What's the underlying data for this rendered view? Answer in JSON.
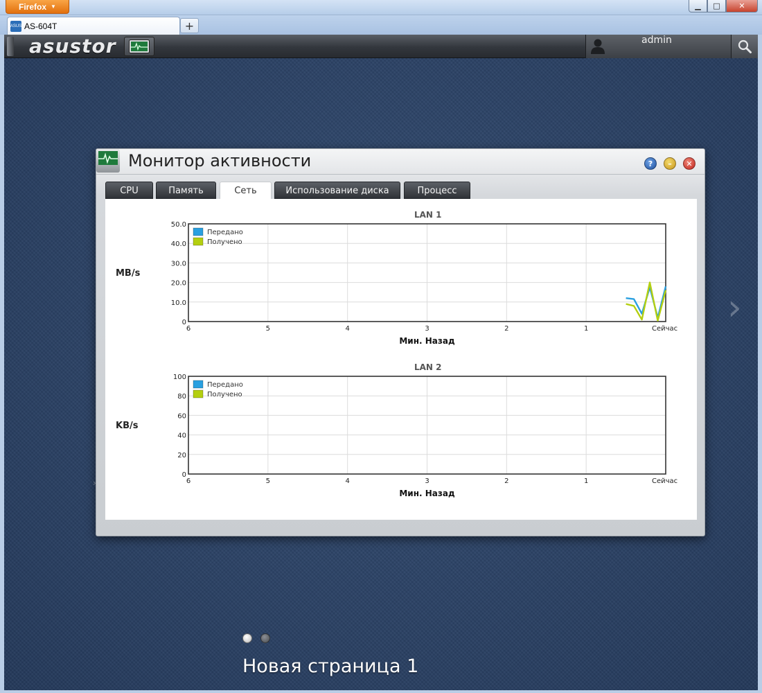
{
  "browser": {
    "menu_label": "Firefox",
    "tab_title": "AS-604T",
    "favicon_text": "ASUS",
    "new_tab_label": "+",
    "minimize": "▁",
    "maximize": "□",
    "close": "✕"
  },
  "topbar": {
    "brand": "asustor",
    "user": "admin"
  },
  "window": {
    "title": "Монитор активности",
    "help": "?",
    "minimize": "–",
    "close": "✕",
    "tabs": [
      {
        "label": "CPU",
        "active": false
      },
      {
        "label": "Память",
        "active": false
      },
      {
        "label": "Сеть",
        "active": true
      },
      {
        "label": "Использование диска",
        "active": false
      },
      {
        "label": "Процесс",
        "active": false
      }
    ]
  },
  "colors": {
    "sent": "#2aa0e0",
    "received": "#b4cf10"
  },
  "desktop": {
    "page_name": "Новая страница 1",
    "next_arrow": "›",
    "left_marker": "›"
  },
  "chart_data": [
    {
      "type": "line",
      "title": "LAN 1",
      "ylabel": "MB/s",
      "xlabel": "Мин. Назад",
      "x_ticks": [
        "6",
        "5",
        "4",
        "3",
        "2",
        "1",
        "Сейчас"
      ],
      "y_ticks": [
        "50.0",
        "40.0",
        "30.0",
        "20.0",
        "10.0",
        "0"
      ],
      "ylim": [
        0,
        50
      ],
      "xlim": [
        6,
        0
      ],
      "grid": true,
      "legend_position": "top-left",
      "series": [
        {
          "name": "Передано",
          "color_key": "sent",
          "x": [
            0.5,
            0.4,
            0.3,
            0.2,
            0.1,
            0.0
          ],
          "y": [
            12,
            11.5,
            4,
            17.5,
            2,
            18
          ]
        },
        {
          "name": "Получено",
          "color_key": "received",
          "x": [
            0.5,
            0.4,
            0.3,
            0.2,
            0.1,
            0.0
          ],
          "y": [
            9,
            8,
            1,
            20,
            0.5,
            16
          ]
        }
      ]
    },
    {
      "type": "line",
      "title": "LAN 2",
      "ylabel": "KB/s",
      "xlabel": "Мин. Назад",
      "x_ticks": [
        "6",
        "5",
        "4",
        "3",
        "2",
        "1",
        "Сейчас"
      ],
      "y_ticks": [
        "100",
        "80",
        "60",
        "40",
        "20",
        "0"
      ],
      "ylim": [
        0,
        100
      ],
      "xlim": [
        6,
        0
      ],
      "grid": true,
      "legend_position": "top-left",
      "series": [
        {
          "name": "Передано",
          "color_key": "sent",
          "x": [],
          "y": []
        },
        {
          "name": "Получено",
          "color_key": "received",
          "x": [],
          "y": []
        }
      ]
    }
  ]
}
